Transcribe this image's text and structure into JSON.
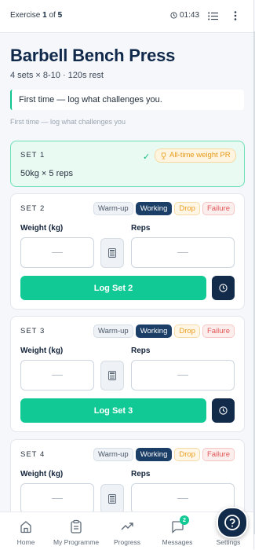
{
  "header": {
    "exercise_word": "Exercise",
    "exercise_current": "1",
    "exercise_of": "of",
    "exercise_total": "5",
    "timer": "01:43"
  },
  "exercise": {
    "name": "Barbell Bench Press",
    "meta": "4 sets × 8-10 · 120s rest",
    "note": "First time — log what challenges you.",
    "note_sub": "First time — log what challenges you"
  },
  "completed_set": {
    "label": "SET 1",
    "pr_badge": "All-time weight PR",
    "summary": "50kg × 5 reps"
  },
  "set_types": [
    "Warm-up",
    "Working",
    "Drop",
    "Failure"
  ],
  "fields": {
    "weight_label": "Weight (kg)",
    "reps_label": "Reps",
    "weight_placeholder": "",
    "reps_placeholder": ""
  },
  "sets": [
    {
      "label": "SET 2",
      "selected_type": "Working",
      "log_label": "Log Set 2"
    },
    {
      "label": "SET 3",
      "selected_type": "Working",
      "log_label": "Log Set 3"
    },
    {
      "label": "SET 4",
      "selected_type": "Working",
      "log_label": ""
    }
  ],
  "nav": {
    "items": [
      {
        "label": "Home",
        "icon": "home-icon"
      },
      {
        "label": "My Programme",
        "icon": "clipboard-icon"
      },
      {
        "label": "Progress",
        "icon": "trend-up-icon"
      },
      {
        "label": "Messages",
        "icon": "chat-icon",
        "badge": "2"
      },
      {
        "label": "Settings",
        "icon": "gear-icon"
      }
    ]
  },
  "colors": {
    "accent": "#10c994",
    "navy": "#132b4a",
    "pr": "#e59a17",
    "drop": "#ea9d1e",
    "failure": "#e05656"
  }
}
